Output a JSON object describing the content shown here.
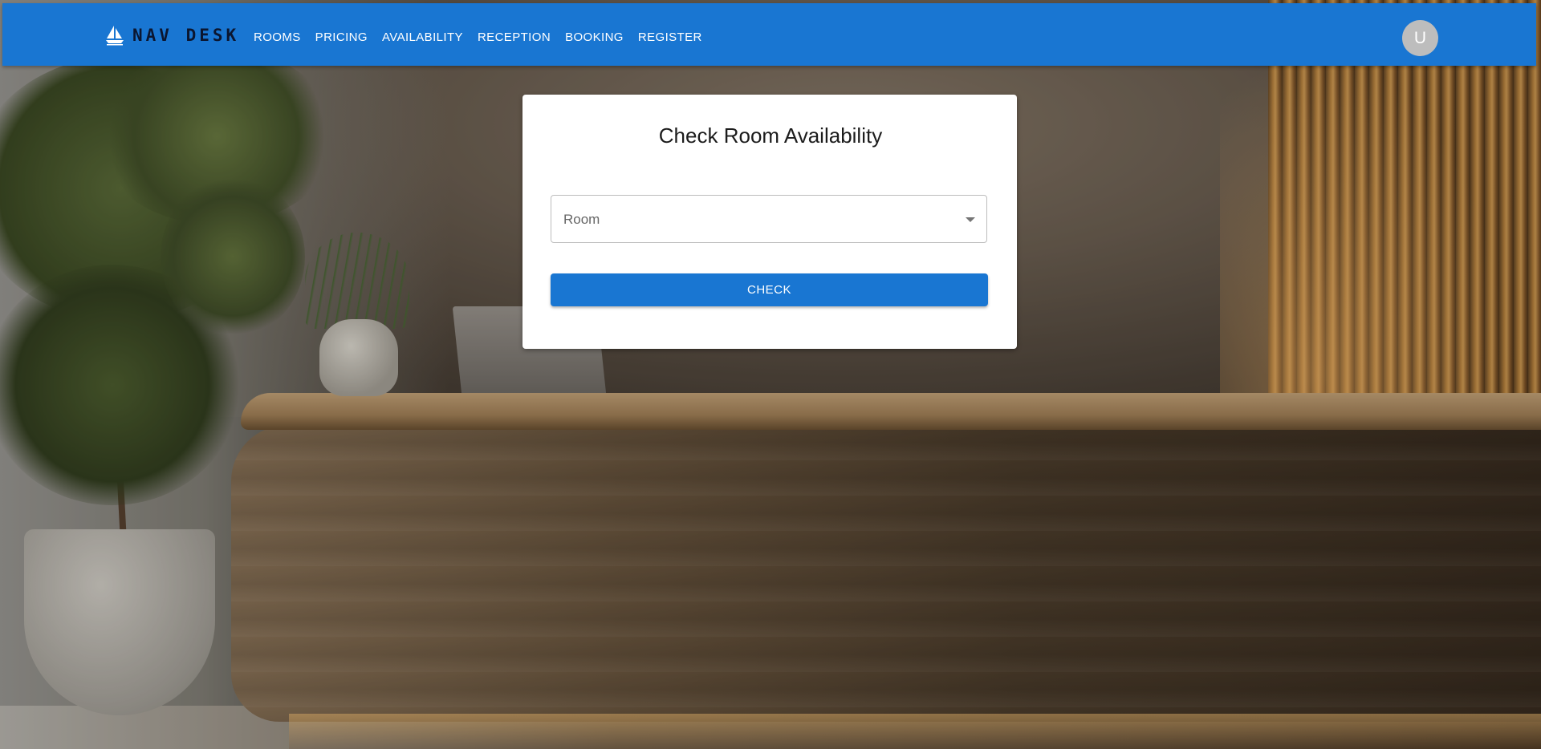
{
  "header": {
    "brand": "NAV DESK",
    "brand_icon": "sailboat-icon",
    "nav_items": [
      "ROOMS",
      "PRICING",
      "AVAILABILITY",
      "RECEPTION",
      "BOOKING",
      "REGISTER"
    ],
    "avatar_letter": "U"
  },
  "card": {
    "title": "Check Room Availability",
    "room_select": {
      "label": "Room",
      "value": "",
      "icon": "caret-down-icon"
    },
    "check_button": "CHECK"
  },
  "colors": {
    "primary": "#1976d2",
    "brand_text": "#0b1630",
    "avatar_bg": "#bdbdbd"
  }
}
